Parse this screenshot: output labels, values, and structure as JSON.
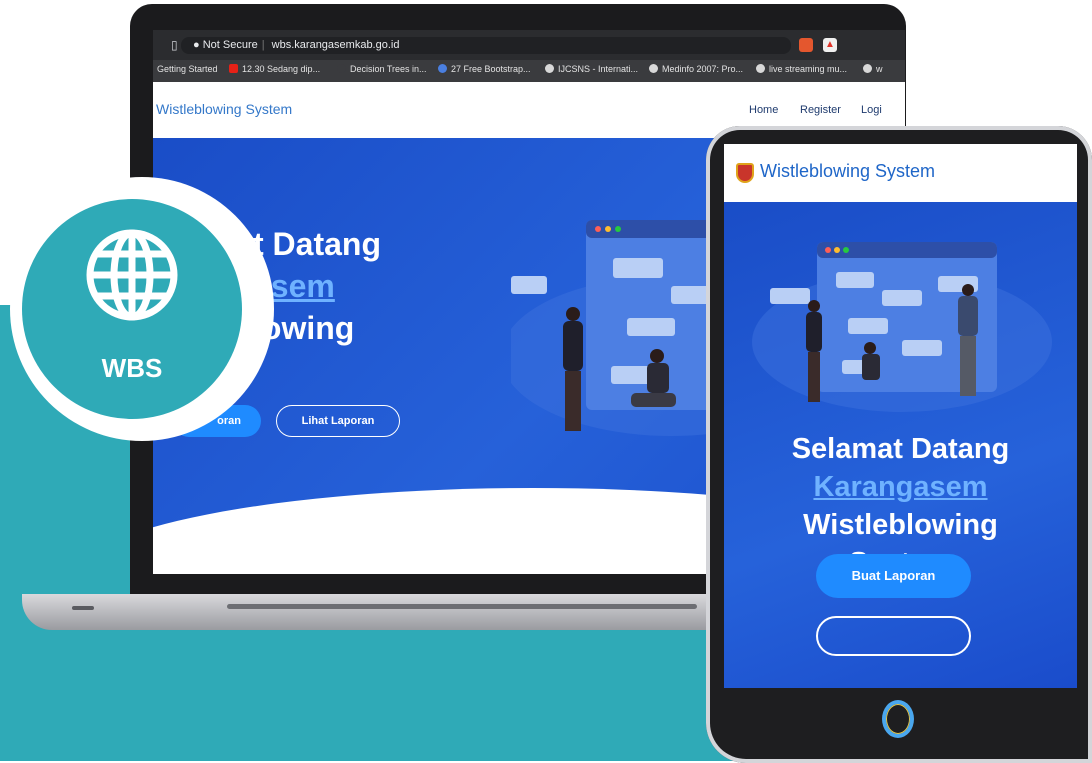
{
  "browser": {
    "not_secure": "Not Secure",
    "url": "wbs.karangasemkab.go.id",
    "bookmarks": [
      "Getting Started",
      "12.30 Sedang dip...",
      "Decision Trees in...",
      "27 Free Bootstrap...",
      "IJCSNS - Internati...",
      "Medinfo 2007: Pro...",
      "live streaming mu...",
      "w"
    ]
  },
  "site": {
    "brand": "Wistleblowing System",
    "nav": {
      "home": "Home",
      "register": "Register",
      "login": "Logi"
    }
  },
  "laptop_hero": {
    "line1": "t Datang",
    "line2": "asem",
    "line3": "lowing",
    "btn_primary": "oran",
    "btn_secondary": "Lihat Laporan"
  },
  "badge": {
    "label": "WBS"
  },
  "tablet": {
    "brand": "Wistleblowing System",
    "title_line1": "Selamat Datang",
    "title_line2": "Karangasem",
    "title_line3": "Wistleblowing",
    "title_line4": "System",
    "btn_primary": "Buat Laporan"
  },
  "colors": {
    "teal": "#2faab7",
    "hero_blue": "#1f55d0",
    "button_blue": "#1f8bff",
    "link_blue": "#6fb2ff"
  }
}
